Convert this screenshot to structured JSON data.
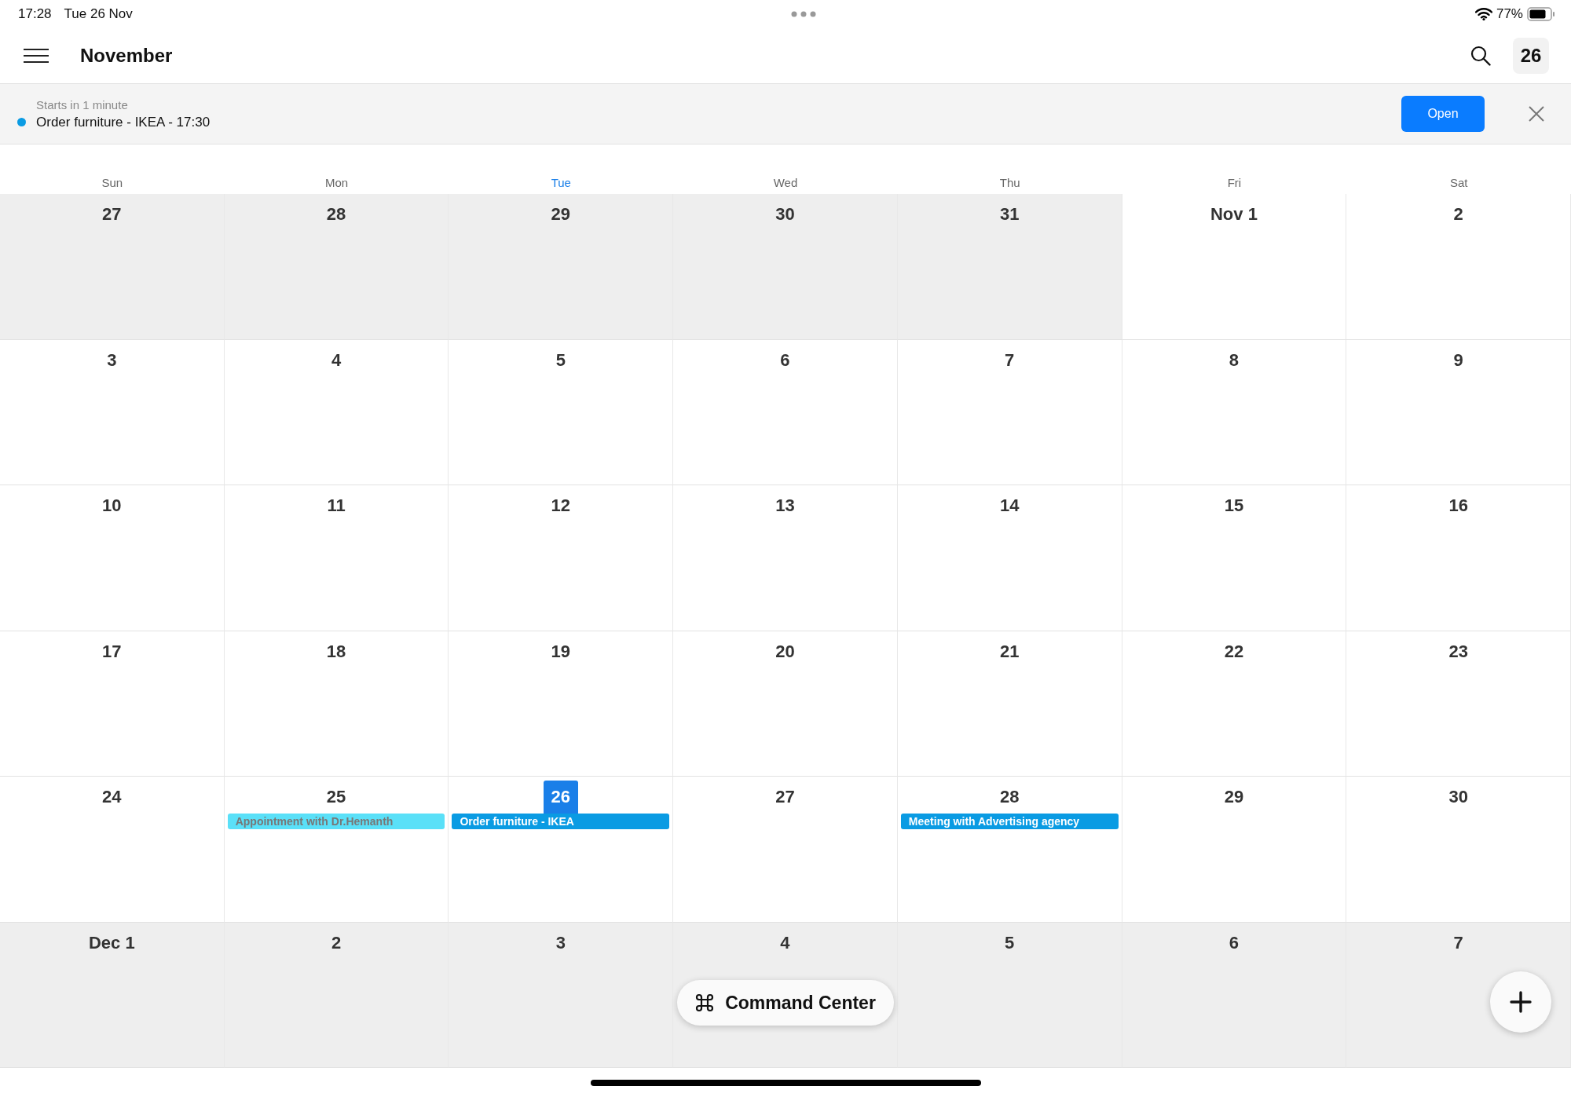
{
  "status_bar": {
    "time": "17:28",
    "date": "Tue 26 Nov",
    "battery_text": "77%"
  },
  "header": {
    "title": "November",
    "today_button": "26"
  },
  "banner": {
    "subtitle": "Starts in 1 minute",
    "title": "Order furniture - IKEA - 17:30",
    "color": "#0a9be3",
    "open_button": "Open"
  },
  "weekdays": [
    {
      "label": "Sun",
      "selected": false
    },
    {
      "label": "Mon",
      "selected": false
    },
    {
      "label": "Tue",
      "selected": true
    },
    {
      "label": "Wed",
      "selected": false
    },
    {
      "label": "Thu",
      "selected": false
    },
    {
      "label": "Fri",
      "selected": false
    },
    {
      "label": "Sat",
      "selected": false
    }
  ],
  "weeks": [
    [
      {
        "label": "27",
        "in_month": false,
        "today": false
      },
      {
        "label": "28",
        "in_month": false,
        "today": false
      },
      {
        "label": "29",
        "in_month": false,
        "today": false
      },
      {
        "label": "30",
        "in_month": false,
        "today": false
      },
      {
        "label": "31",
        "in_month": false,
        "today": false
      },
      {
        "label": "Nov 1",
        "in_month": true,
        "today": false
      },
      {
        "label": "2",
        "in_month": true,
        "today": false
      }
    ],
    [
      {
        "label": "3",
        "in_month": true,
        "today": false
      },
      {
        "label": "4",
        "in_month": true,
        "today": false
      },
      {
        "label": "5",
        "in_month": true,
        "today": false
      },
      {
        "label": "6",
        "in_month": true,
        "today": false
      },
      {
        "label": "7",
        "in_month": true,
        "today": false
      },
      {
        "label": "8",
        "in_month": true,
        "today": false
      },
      {
        "label": "9",
        "in_month": true,
        "today": false
      }
    ],
    [
      {
        "label": "10",
        "in_month": true,
        "today": false
      },
      {
        "label": "11",
        "in_month": true,
        "today": false
      },
      {
        "label": "12",
        "in_month": true,
        "today": false
      },
      {
        "label": "13",
        "in_month": true,
        "today": false
      },
      {
        "label": "14",
        "in_month": true,
        "today": false
      },
      {
        "label": "15",
        "in_month": true,
        "today": false
      },
      {
        "label": "16",
        "in_month": true,
        "today": false
      }
    ],
    [
      {
        "label": "17",
        "in_month": true,
        "today": false
      },
      {
        "label": "18",
        "in_month": true,
        "today": false
      },
      {
        "label": "19",
        "in_month": true,
        "today": false
      },
      {
        "label": "20",
        "in_month": true,
        "today": false
      },
      {
        "label": "21",
        "in_month": true,
        "today": false
      },
      {
        "label": "22",
        "in_month": true,
        "today": false
      },
      {
        "label": "23",
        "in_month": true,
        "today": false
      }
    ],
    [
      {
        "label": "24",
        "in_month": true,
        "today": false
      },
      {
        "label": "25",
        "in_month": true,
        "today": false,
        "events": [
          {
            "title": "Appointment with Dr.Hemanth",
            "color": "#5ae0f8",
            "past": true
          }
        ]
      },
      {
        "label": "26",
        "in_month": true,
        "today": true,
        "events": [
          {
            "title": "Order furniture - IKEA",
            "color": "#0a9be3",
            "past": false
          }
        ]
      },
      {
        "label": "27",
        "in_month": true,
        "today": false
      },
      {
        "label": "28",
        "in_month": true,
        "today": false,
        "events": [
          {
            "title": "Meeting with Advertising agency",
            "color": "#0a9be3",
            "past": false
          }
        ]
      },
      {
        "label": "29",
        "in_month": true,
        "today": false
      },
      {
        "label": "30",
        "in_month": true,
        "today": false
      }
    ],
    [
      {
        "label": "Dec 1",
        "in_month": false,
        "today": false
      },
      {
        "label": "2",
        "in_month": false,
        "today": false
      },
      {
        "label": "3",
        "in_month": false,
        "today": false
      },
      {
        "label": "4",
        "in_month": false,
        "today": false
      },
      {
        "label": "5",
        "in_month": false,
        "today": false
      },
      {
        "label": "6",
        "in_month": false,
        "today": false
      },
      {
        "label": "7",
        "in_month": false,
        "today": false
      }
    ]
  ],
  "command_button": "Command Center"
}
